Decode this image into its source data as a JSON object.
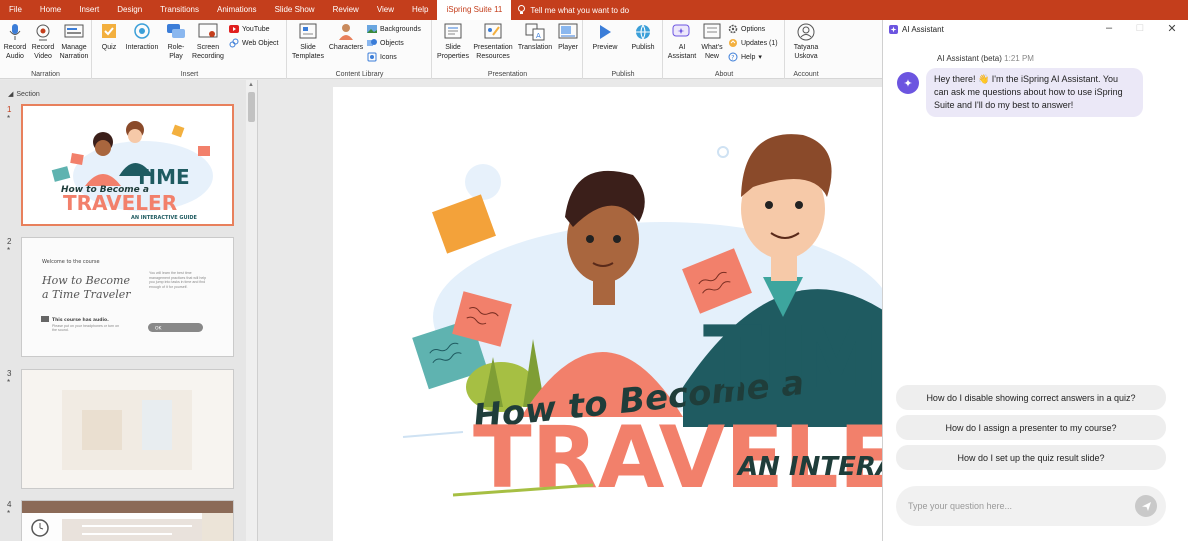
{
  "menu": {
    "items": [
      "File",
      "Home",
      "Insert",
      "Design",
      "Transitions",
      "Animations",
      "Slide Show",
      "Review",
      "View",
      "Help",
      "iSpring Suite 11"
    ],
    "tell_me": "Tell me what you want to do"
  },
  "ribbon": {
    "narration": {
      "label": "Narration",
      "record_audio": "Record Audio",
      "record_video": "Record Video",
      "manage_narration": "Manage Narration"
    },
    "insert": {
      "label": "Insert",
      "quiz": "Quiz",
      "interaction": "Interaction",
      "role_play": "Role-Play",
      "screen_recording": "Screen Recording",
      "youtube": "YouTube",
      "web_object": "Web Object"
    },
    "content_library": {
      "label": "Content Library",
      "slide_templates": "Slide Templates",
      "characters": "Characters",
      "backgrounds": "Backgrounds",
      "objects": "Objects",
      "icons": "Icons"
    },
    "presentation": {
      "label": "Presentation",
      "slide_properties": "Slide Properties",
      "presentation_resources": "Presentation Resources",
      "translation": "Translation",
      "player": "Player"
    },
    "publish": {
      "label": "Publish",
      "preview": "Preview",
      "publish": "Publish"
    },
    "about": {
      "label": "About",
      "ai_assistant": "AI Assistant",
      "whats_new": "What's New",
      "options": "Options",
      "updates": "Updates (1)",
      "help": "Help"
    },
    "account": {
      "label": "Account",
      "user": "Tatyana Uskova"
    }
  },
  "thumbnails": {
    "section": "Section",
    "slides": [
      {
        "num": "1",
        "star": "*",
        "title_line1": "How to Become a",
        "title_big1": "TIME",
        "title_big2": "TRAVELER",
        "subtitle": "AN INTERACTIVE GUIDE"
      },
      {
        "num": "2",
        "star": "*",
        "welcome": "Welcome to the course",
        "script1": "How to Become",
        "script2": "a Time Traveler",
        "body": "You will learn the best time management practices that will help you jump into tasks in time and find enough of it for yourself.",
        "audio": "This course has audio.",
        "audio_hint": "Please put on your headphones or turn on the sound.",
        "button": "OK"
      },
      {
        "num": "3",
        "star": "*"
      },
      {
        "num": "4",
        "star": "*"
      }
    ]
  },
  "slide": {
    "line1": "How to Become a",
    "big1": "TIME",
    "big2": "TRAVELER",
    "subtitle": "AN INTERACTIVE GUIDE"
  },
  "ai": {
    "title": "AI Assistant",
    "sender": "AI Assistant (beta)",
    "time": "1:21 PM",
    "message": "Hey there! 👋 I'm the iSpring AI Assistant. You can ask me questions about how to use iSpring Suite and I'll do my best to answer!",
    "suggestions": [
      "How do I disable showing correct answers in a quiz?",
      "How do I assign a presenter to my course?",
      "How do I set up the quiz result slide?"
    ],
    "input_placeholder": "Type your question here..."
  },
  "colors": {
    "accent": "#c43e1c",
    "ai_purple": "#6c55e0",
    "coral": "#f2806b",
    "teal": "#1f5b61"
  }
}
